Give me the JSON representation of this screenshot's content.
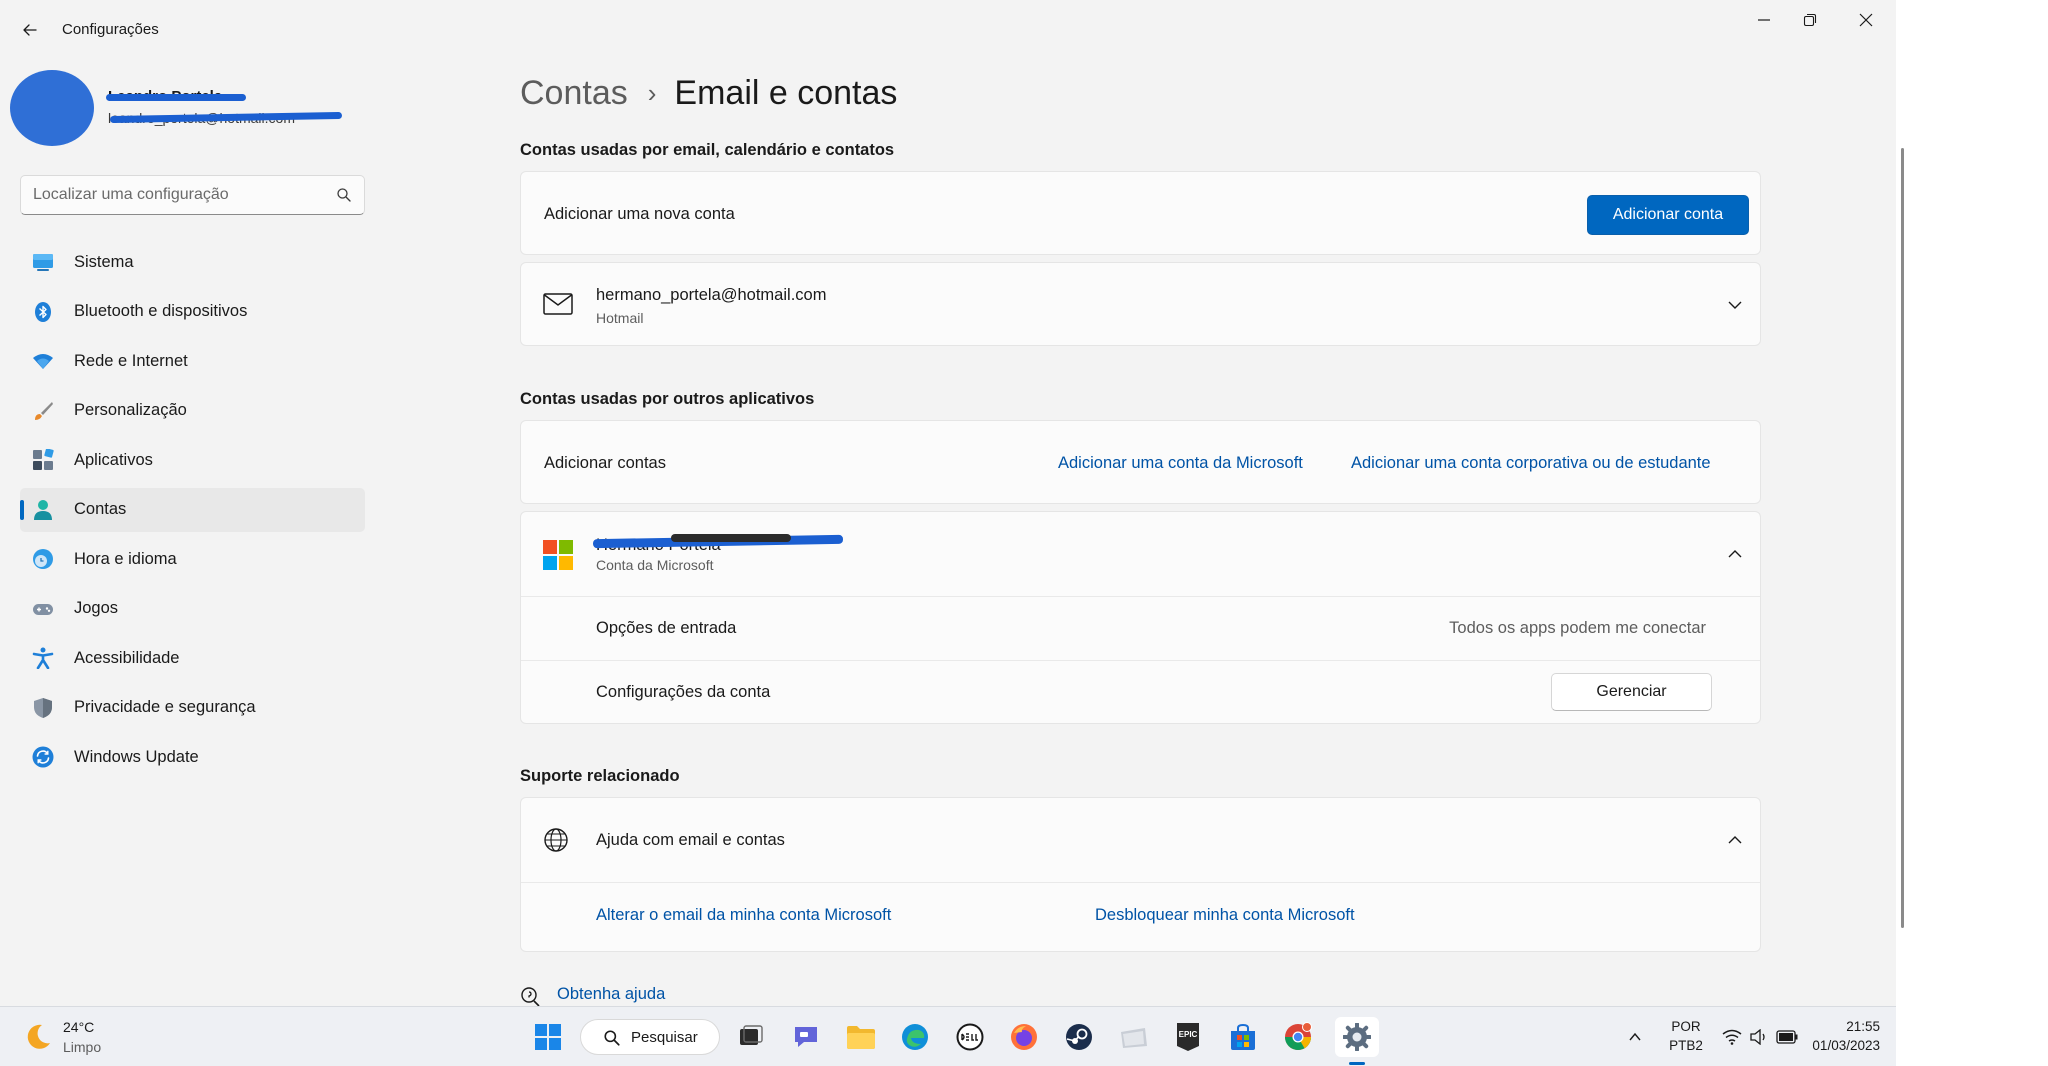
{
  "window": {
    "app_title": "Configurações"
  },
  "profile": {
    "name": "Leandro Portela",
    "email": "leandro_portela@hotmail.com"
  },
  "search": {
    "placeholder": "Localizar uma configuração"
  },
  "nav": {
    "items": [
      {
        "label": "Sistema",
        "icon": "monitor-icon"
      },
      {
        "label": "Bluetooth e dispositivos",
        "icon": "bluetooth-icon"
      },
      {
        "label": "Rede e Internet",
        "icon": "wifi-icon"
      },
      {
        "label": "Personalização",
        "icon": "brush-icon"
      },
      {
        "label": "Aplicativos",
        "icon": "apps-icon"
      },
      {
        "label": "Contas",
        "icon": "person-icon",
        "active": true
      },
      {
        "label": "Hora e idioma",
        "icon": "globe-clock-icon"
      },
      {
        "label": "Jogos",
        "icon": "gamepad-icon"
      },
      {
        "label": "Acessibilidade",
        "icon": "accessibility-icon"
      },
      {
        "label": "Privacidade e segurança",
        "icon": "shield-icon"
      },
      {
        "label": "Windows Update",
        "icon": "update-icon"
      }
    ]
  },
  "breadcrumb": {
    "parent": "Contas",
    "separator": "›",
    "current": "Email e contas"
  },
  "email_section": {
    "title": "Contas usadas por email, calendário e contatos",
    "add_label": "Adicionar uma nova conta",
    "add_button": "Adicionar conta",
    "account_email": "hermano_portela@hotmail.com",
    "account_type": "Hotmail"
  },
  "other_apps_section": {
    "title": "Contas usadas por outros aplicativos",
    "add_label": "Adicionar contas",
    "add_microsoft_link": "Adicionar uma conta da Microsoft",
    "add_work_link": "Adicionar uma conta corporativa ou de estudante",
    "account_name": "Hermano Portela",
    "account_type": "Conta da Microsoft",
    "signin_options_label": "Opções de entrada",
    "signin_options_value": "Todos os apps podem me conectar",
    "account_settings_label": "Configurações da conta",
    "manage_button": "Gerenciar"
  },
  "support_section": {
    "title": "Suporte relacionado",
    "help_label": "Ajuda com email e contas",
    "link_change_email": "Alterar o email da minha conta Microsoft",
    "link_unlock": "Desbloquear minha conta Microsoft"
  },
  "get_help": {
    "label": "Obtenha ajuda"
  },
  "taskbar": {
    "weather_temp": "24°C",
    "weather_desc": "Limpo",
    "search_label": "Pesquisar",
    "lang_line1": "POR",
    "lang_line2": "PTB2",
    "time": "21:55",
    "date": "01/03/2023"
  },
  "colors": {
    "accent": "#0067c0",
    "link": "#0053a6",
    "window_bg": "#f3f3f3",
    "card_bg": "#fbfbfb"
  }
}
